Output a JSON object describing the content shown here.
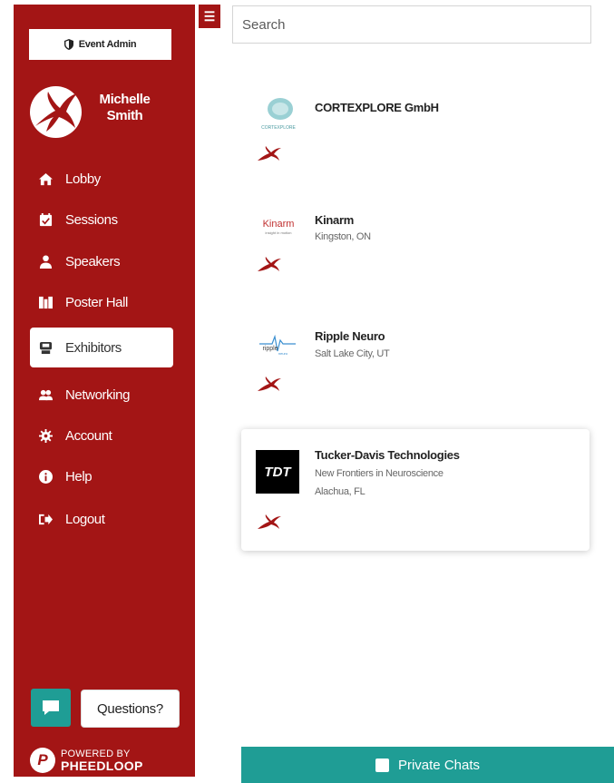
{
  "admin_button": {
    "label": "Event Admin"
  },
  "user": {
    "name": "Michelle Smith"
  },
  "nav": {
    "items": [
      {
        "label": "Lobby",
        "icon": "home-icon"
      },
      {
        "label": "Sessions",
        "icon": "calendar-icon"
      },
      {
        "label": "Speakers",
        "icon": "user-tie-icon"
      },
      {
        "label": "Poster Hall",
        "icon": "poster-icon"
      },
      {
        "label": "Exhibitors",
        "icon": "booth-icon",
        "active": true
      },
      {
        "label": "Networking",
        "icon": "users-icon"
      },
      {
        "label": "Account",
        "icon": "gear-icon"
      },
      {
        "label": "Help",
        "icon": "info-icon"
      },
      {
        "label": "Logout",
        "icon": "logout-icon"
      }
    ]
  },
  "search": {
    "placeholder": "Search"
  },
  "exhibitors": [
    {
      "name": "CORTEXPLORE GmbH",
      "logo_text": "CORTEXPLORE"
    },
    {
      "name": "Kinarm",
      "location": "Kingston, ON",
      "logo_text": "Kinarm",
      "logo_tagline": "insight in motion"
    },
    {
      "name": "Ripple Neuro",
      "location": "Salt Lake City, UT",
      "logo_text": "ripple",
      "logo_tagline": "neuro"
    },
    {
      "name": "Tucker-Davis Technologies",
      "tagline": "New Frontiers in Neuroscience",
      "location": "Alachua, FL",
      "logo_text": "TDT"
    }
  ],
  "questions_button": {
    "label": "Questions?"
  },
  "powered_by": {
    "line1": "POWERED BY",
    "line2": "PHEEDLOOP"
  },
  "private_chats": {
    "label": "Private Chats"
  },
  "colors": {
    "brand": "#a31515",
    "teal": "#1f9d95"
  }
}
